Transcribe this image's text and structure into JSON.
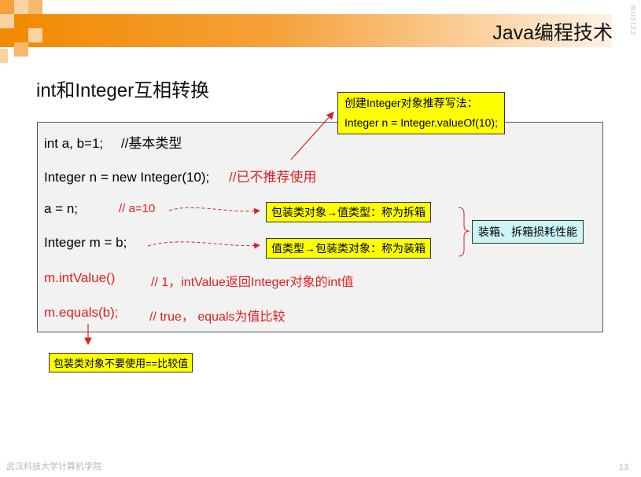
{
  "header": {
    "title": "Java编程技术",
    "watermark": "wustzz"
  },
  "slide": {
    "heading": "int和Integer互相转换",
    "code_lines": [
      {
        "code": "int a, b=1;",
        "comment": "//基本类型"
      },
      {
        "code": "Integer n = new Integer(10);",
        "comment": "//已不推荐使用"
      },
      {
        "code": "a = n;",
        "comment": "// a=10"
      },
      {
        "code": "Integer m = b;",
        "comment": ""
      },
      {
        "code": "m.intValue()",
        "comment": "// 1，intValue返回Integer对象的int值"
      },
      {
        "code": "m.equals(b);",
        "comment": "// true， equals为值比较"
      }
    ],
    "callouts": {
      "recommend": {
        "line1": "创建Integer对象推荐写法：",
        "line2": "Integer n = Integer.valueOf(10);"
      },
      "unboxing": "包装类对象→值类型：称为拆箱",
      "boxing": "值类型→包装类对象：称为装箱",
      "cost": "装箱、拆箱损耗性能",
      "compare": "包装类对象不要使用==比较值"
    }
  },
  "footer": {
    "org": "武汉科技大学计算机学院",
    "page": "13"
  },
  "colors": {
    "accent": "#f08a00",
    "red": "#e02020",
    "yellow": "#ffff00",
    "cyan": "#ccf5f8"
  }
}
